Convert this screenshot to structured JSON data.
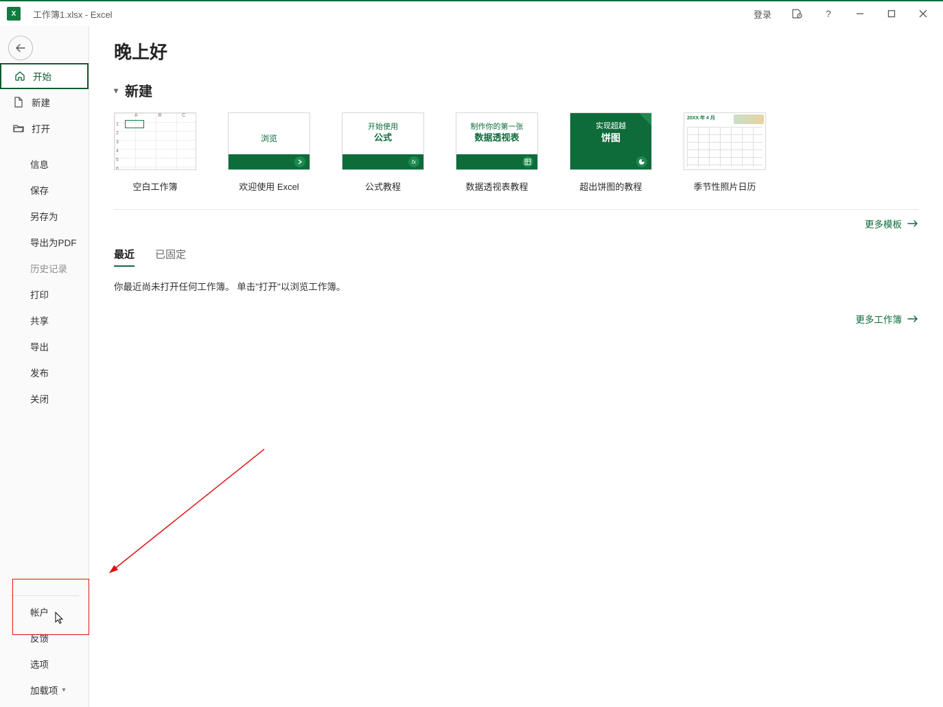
{
  "titlebar": {
    "caption": "工作簿1.xlsx  -  Excel",
    "sign_in": "登录"
  },
  "sidebar": {
    "home": "开始",
    "new": "新建",
    "open": "打开",
    "info": "信息",
    "save": "保存",
    "save_as": "另存为",
    "export_pdf": "导出为PDF",
    "history": "历史记录",
    "print": "打印",
    "share": "共享",
    "export": "导出",
    "publish": "发布",
    "close": "关闭",
    "account": "帐户",
    "feedback": "反馈",
    "options": "选项",
    "addins": "加载项"
  },
  "main": {
    "greeting": "晚上好",
    "new_section": "新建",
    "templates": [
      {
        "label": "空白工作簿"
      },
      {
        "label": "欢迎使用 Excel",
        "browse": "浏览"
      },
      {
        "label": "公式教程",
        "line1": "开始使用",
        "line2": "公式"
      },
      {
        "label": "数据透视表教程",
        "line1": "制作你的第一张",
        "line2": "数据透视表"
      },
      {
        "label": "超出饼图的教程",
        "line1": "实现超越",
        "line2": "饼图"
      },
      {
        "label": "季节性照片日历",
        "cal_head": "20XX 年 4 月"
      }
    ],
    "more_templates": "更多模板",
    "tabs": {
      "recent": "最近",
      "pinned": "已固定"
    },
    "empty_hint": "你最近尚未打开任何工作簿。 单击\"打开\"以浏览工作簿。",
    "more_workbooks": "更多工作簿"
  }
}
